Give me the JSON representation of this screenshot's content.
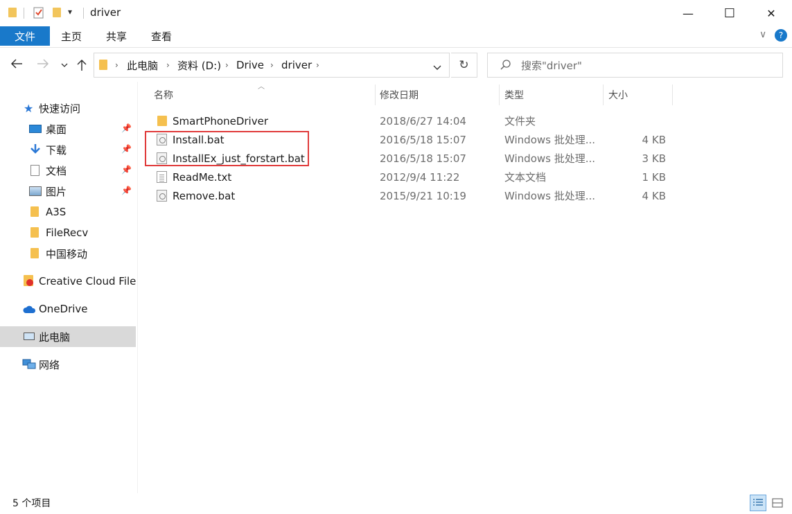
{
  "window": {
    "title": "driver",
    "minimize_glyph": "—",
    "maximize_glyph": "☐",
    "close_glyph": "✕"
  },
  "ribbon": {
    "tabs": [
      "文件",
      "主页",
      "共享",
      "查看"
    ],
    "expand_glyph": "∨",
    "help_glyph": "?"
  },
  "address": {
    "crumbs": [
      "此电脑",
      "资料 (D:)",
      "Drive",
      "driver"
    ],
    "search_placeholder": "搜索\"driver\""
  },
  "nav": {
    "quick_access": "快速访问",
    "items": [
      {
        "label": "桌面",
        "icon": "desktop-icon",
        "pinned": true
      },
      {
        "label": "下载",
        "icon": "download-icon",
        "pinned": true
      },
      {
        "label": "文档",
        "icon": "document-icon",
        "pinned": true
      },
      {
        "label": "图片",
        "icon": "pictures-icon",
        "pinned": true
      },
      {
        "label": "A3S",
        "icon": "folder-icon",
        "pinned": false
      },
      {
        "label": "FileRecv",
        "icon": "folder-icon",
        "pinned": false
      },
      {
        "label": "中国移动",
        "icon": "folder-icon",
        "pinned": false
      }
    ],
    "creative_cloud": "Creative Cloud Files",
    "onedrive": "OneDrive",
    "this_pc": "此电脑",
    "network": "网络"
  },
  "columns": {
    "name": "名称",
    "modified": "修改日期",
    "type": "类型",
    "size": "大小"
  },
  "files": [
    {
      "name": "SmartPhoneDriver",
      "modified": "2018/6/27 14:04",
      "type": "文件夹",
      "size": "",
      "icon": "folder-icon"
    },
    {
      "name": "Install.bat",
      "modified": "2016/5/18 15:07",
      "type": "Windows 批处理...",
      "size": "4 KB",
      "icon": "batch-file-icon"
    },
    {
      "name": "InstallEx_just_forstart.bat",
      "modified": "2016/5/18 15:07",
      "type": "Windows 批处理...",
      "size": "3 KB",
      "icon": "batch-file-icon"
    },
    {
      "name": "ReadMe.txt",
      "modified": "2012/9/4 11:22",
      "type": "文本文档",
      "size": "1 KB",
      "icon": "text-file-icon"
    },
    {
      "name": "Remove.bat",
      "modified": "2015/9/21 10:19",
      "type": "Windows 批处理...",
      "size": "4 KB",
      "icon": "batch-file-icon"
    }
  ],
  "status": {
    "item_count": "5 个项目"
  },
  "colors": {
    "accent": "#1979ca",
    "highlight_box": "#e03a3a",
    "selected_nav": "#d9d9d9"
  }
}
